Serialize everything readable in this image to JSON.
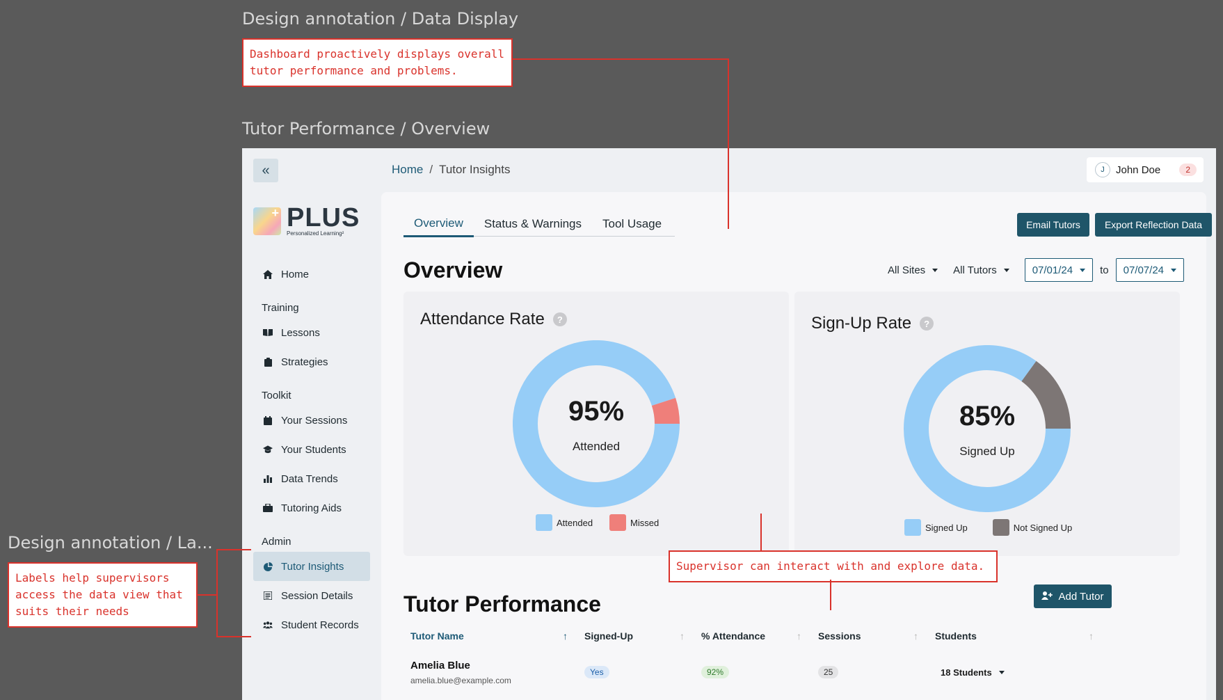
{
  "canvas": {
    "label_top": "Design annotation / Data Display",
    "label_section": "Tutor Performance / Overview",
    "label_left": "Design annotation / La..."
  },
  "annotations": {
    "top": "Dashboard proactively displays overall tutor performance and problems.",
    "left": "Labels help supervisors access the data view that suits their needs",
    "middle": "Supervisor can interact with and explore data."
  },
  "app": {
    "collapse_icon": "«",
    "logo": {
      "word": "PLUS",
      "sub": "Personalized Learning²"
    },
    "breadcrumb": {
      "home": "Home",
      "separator": "/",
      "current": "Tutor Insights"
    },
    "user": {
      "initial": "J",
      "name": "John Doe",
      "notifications": "2"
    }
  },
  "sidebar": {
    "home": "Home",
    "sections": {
      "training": "Training",
      "toolkit": "Toolkit",
      "admin": "Admin"
    },
    "items": {
      "lessons": "Lessons",
      "strategies": "Strategies",
      "your_sessions": "Your Sessions",
      "your_students": "Your Students",
      "data_trends": "Data Trends",
      "tutoring_aids": "Tutoring Aids",
      "tutor_insights": "Tutor Insights",
      "session_details": "Session Details",
      "student_records": "Student Records"
    }
  },
  "tabs": {
    "overview": "Overview",
    "status": "Status & Warnings",
    "tool_usage": "Tool Usage"
  },
  "actions": {
    "email": "Email Tutors",
    "export": "Export Reflection Data",
    "add_tutor": "Add Tutor"
  },
  "overview": {
    "title": "Overview",
    "filters": {
      "sites": "All Sites",
      "tutors": "All Tutors",
      "from": "07/01/24",
      "to_label": "to",
      "to": "07/07/24"
    }
  },
  "attendance": {
    "title": "Attendance Rate",
    "help": "?",
    "percent": "95%",
    "label": "Attended",
    "value": 0.95,
    "legend": {
      "a": "Attended",
      "b": "Missed"
    }
  },
  "signup": {
    "title": "Sign-Up Rate",
    "help": "?",
    "percent": "85%",
    "label": "Signed Up",
    "value": 0.85,
    "legend": {
      "a": "Signed Up",
      "b": "Not Signed Up"
    }
  },
  "colors": {
    "blue": "#96cdf7",
    "red": "#ef7f7a",
    "gray": "#7d7675",
    "accent": "#1f5569"
  },
  "performance": {
    "title": "Tutor Performance",
    "headers": {
      "name": "Tutor Name",
      "signed": "Signed-Up",
      "attendance": "% Attendance",
      "sessions": "Sessions",
      "students": "Students"
    },
    "sort_arrow": "↑",
    "rows": [
      {
        "name": "Amelia Blue",
        "email": "amelia.blue@example.com",
        "signed": "Yes",
        "attendance": "92%",
        "sessions": "25",
        "students": "18 Students"
      }
    ]
  }
}
